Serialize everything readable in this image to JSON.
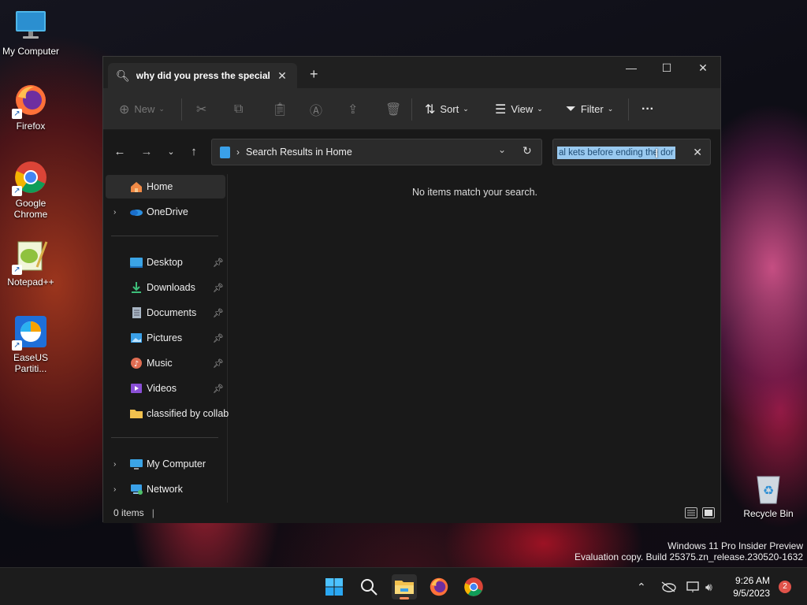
{
  "desktop": {
    "icons": [
      {
        "label": "My Computer",
        "icon": "monitor-icon"
      },
      {
        "label": "Firefox",
        "icon": "firefox-icon"
      },
      {
        "label": "Google Chrome",
        "icon": "chrome-icon"
      },
      {
        "label": "Notepad++",
        "icon": "notepadpp-icon"
      },
      {
        "label": "EaseUS Partiti...",
        "icon": "easeus-icon"
      },
      {
        "label": "Recycle Bin",
        "icon": "recycle-bin-icon"
      }
    ],
    "watermark": {
      "line1": "Windows 11 Pro Insider Preview",
      "line2": "Evaluation copy. Build 25375.zn_release.230520-1632"
    }
  },
  "explorer": {
    "tab_title": "why did you press the special",
    "toolbar": {
      "new": "New",
      "sort": "Sort",
      "view": "View",
      "filter": "Filter",
      "more": "···"
    },
    "address": {
      "location": "Search Results in Home"
    },
    "search": {
      "value": "al kets before ending the dor"
    },
    "sidebar": {
      "items": [
        {
          "label": "Home",
          "icon": "home-icon",
          "selected": true
        },
        {
          "label": "OneDrive",
          "icon": "cloud-icon",
          "expandable": true
        },
        {
          "label": "Desktop",
          "icon": "desktop-folder-icon",
          "pinned": true
        },
        {
          "label": "Downloads",
          "icon": "download-icon",
          "pinned": true
        },
        {
          "label": "Documents",
          "icon": "document-icon",
          "pinned": true
        },
        {
          "label": "Pictures",
          "icon": "picture-icon",
          "pinned": true
        },
        {
          "label": "Music",
          "icon": "music-icon",
          "pinned": true
        },
        {
          "label": "Videos",
          "icon": "video-icon",
          "pinned": true
        },
        {
          "label": "classified by collaborators",
          "icon": "folder-icon"
        },
        {
          "label": "My Computer",
          "icon": "monitor-icon",
          "expandable": true
        },
        {
          "label": "Network",
          "icon": "network-icon",
          "expandable": true
        }
      ]
    },
    "content": {
      "empty_message": "No items match your search."
    },
    "status": {
      "count": "0 items",
      "cursor": "|"
    }
  },
  "taskbar": {
    "clock_time": "9:26 AM",
    "clock_date": "9/5/2023",
    "notification_count": "2"
  },
  "colors": {
    "accent": "#ff8c5a",
    "selection": "#99c9ef",
    "window_bg": "#191919",
    "toolbar_bg": "#2b2b2b"
  }
}
